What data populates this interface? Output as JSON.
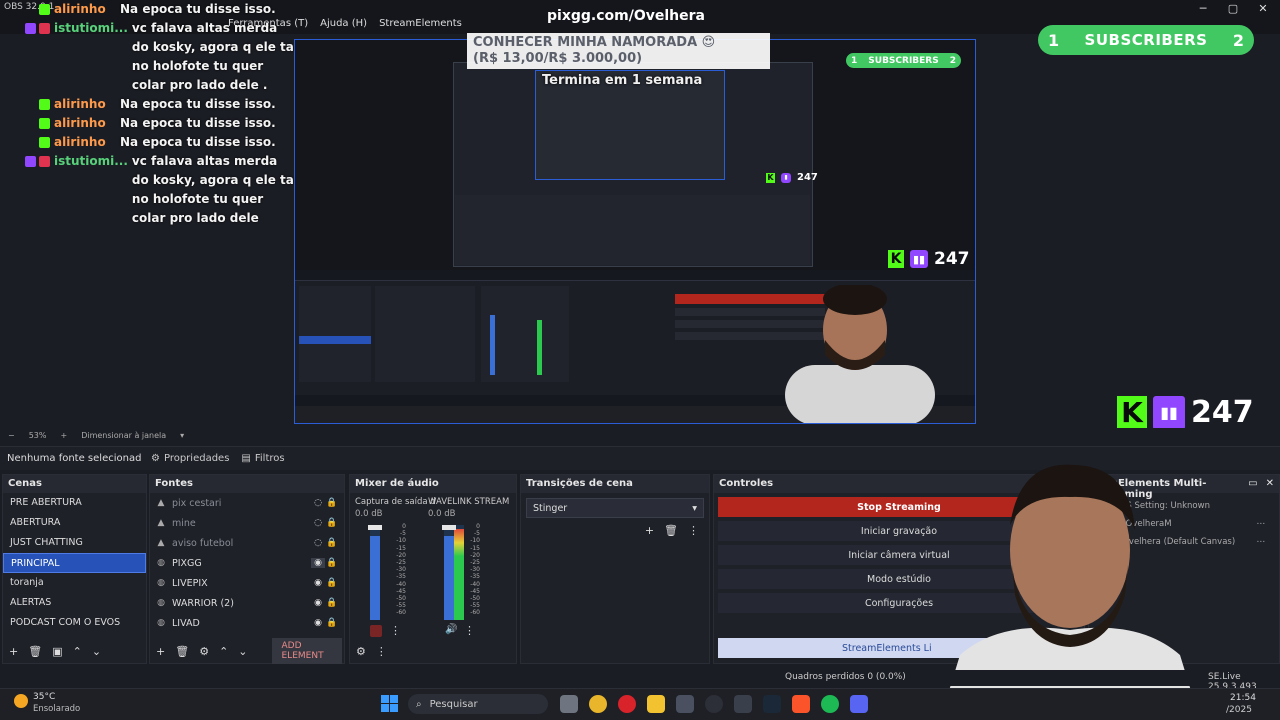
{
  "window": {
    "obs_title": "OBS 32.0.1",
    "menu": [
      "Ferramentas (T)",
      "Ajuda (H)",
      "StreamElements"
    ]
  },
  "overlay_url": "pixgg.com/Ovelhera",
  "chat": [
    {
      "user": "alirinho",
      "message": "Na epoca tu disse isso.",
      "user_color": "green"
    },
    {
      "user": "istutiomi...",
      "message": "vc falava altas merda do kosky, agora q ele ta no holofote tu quer colar pro lado dele .",
      "user_color": "cyan"
    },
    {
      "user": "alirinho",
      "message": "Na epoca tu disse isso.",
      "user_color": "green"
    },
    {
      "user": "alirinho",
      "message": "Na epoca tu disse isso.",
      "user_color": "green"
    },
    {
      "user": "alirinho",
      "message": "Na epoca tu disse isso.",
      "user_color": "green"
    },
    {
      "user": "istutiomi...",
      "message": "vc falava altas merda do kosky, agora q ele ta no holofote tu quer colar pro lado dele",
      "user_color": "cyan"
    }
  ],
  "goal_banner": {
    "title": "CONHECER MINHA NAMORADA 😍",
    "amount": "(R$ 13,00/R$ 3.000,00)",
    "sub": "Termina em 1 semana"
  },
  "subscribers": {
    "left": "1",
    "label": "SUBSCRIBERS",
    "right": "2"
  },
  "viewers": {
    "count": "247"
  },
  "zoom": {
    "percent": "53%",
    "label": "Dimensionar à janela"
  },
  "source_toolbar": {
    "no_source": "Nenhuma fonte selecionad",
    "properties": "Propriedades",
    "filters": "Filtros"
  },
  "scenes": {
    "title": "Cenas",
    "items": [
      "PRE ABERTURA",
      "ABERTURA",
      "JUST CHATTING",
      "PRINCIPAL",
      "toranja",
      "ALERTAS",
      "PODCAST COM O EVOS"
    ],
    "active_index": 3
  },
  "sources": {
    "title": "Fontes",
    "items": [
      {
        "name": "pix cestari",
        "dim": true
      },
      {
        "name": "mine",
        "dim": true
      },
      {
        "name": "aviso futebol",
        "dim": true
      },
      {
        "name": "PIXGG",
        "dim": false
      },
      {
        "name": "LIVEPIX",
        "dim": false
      },
      {
        "name": "WARRIOR (2)",
        "dim": false
      },
      {
        "name": "LIVAD",
        "dim": false
      }
    ],
    "add_element": "ADD ELEMENT"
  },
  "mixer": {
    "title": "Mixer de áudio",
    "ch1": {
      "name": "Captura de saída d",
      "db": "0.0 dB"
    },
    "ch2": {
      "name": "WAVELINK STREAM",
      "db": "0.0 dB"
    },
    "scale": [
      "0",
      "-5",
      "-10",
      "-15",
      "-20",
      "-25",
      "-30",
      "-35",
      "-40",
      "-45",
      "-50",
      "-55",
      "-60"
    ]
  },
  "transitions": {
    "title": "Transições de cena",
    "selected": "Stinger"
  },
  "controls": {
    "title": "Controles",
    "buttons": [
      "Stop Streaming",
      "Iniciar gravação",
      "Iniciar câmera virtual",
      "Modo estúdio",
      "Configurações"
    ],
    "se_button": "StreamElements Li"
  },
  "multistream": {
    "title": "eamElements Multi-Streaming",
    "items": [
      "OBS Setting: Unknown",
      "OvelheraM",
      "ovelhera (Default Canvas)"
    ]
  },
  "status": {
    "dropped_frames": "Quadros perdidos 0 (0.0%)",
    "se_version": "SE.Live 25.9.3.493"
  },
  "taskbar": {
    "weather_temp": "35°C",
    "weather_label": "Ensolarado",
    "search": "Pesquisar",
    "time": "21:54",
    "date": "/2025"
  },
  "colors": {
    "accent": "#2753b8",
    "stop_red": "#b3261e",
    "subs_green": "#42c862",
    "kick_green": "#53fc18",
    "twitch_purple": "#9146ff"
  }
}
